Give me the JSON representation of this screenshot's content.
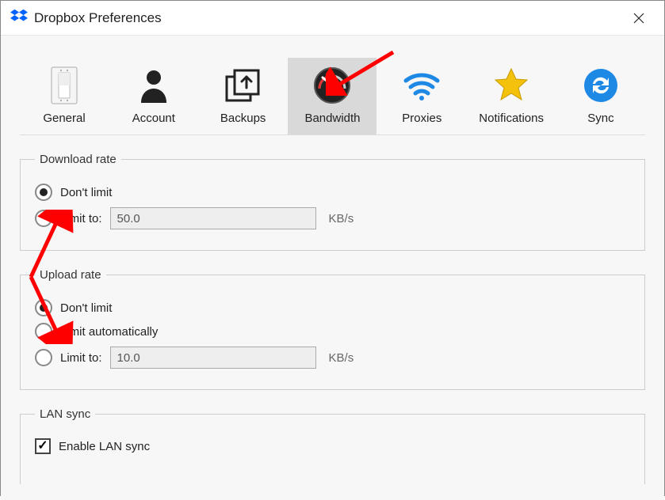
{
  "window": {
    "title": "Dropbox Preferences"
  },
  "tabs": {
    "general": "General",
    "account": "Account",
    "backups": "Backups",
    "bandwidth": "Bandwidth",
    "proxies": "Proxies",
    "notifications": "Notifications",
    "sync": "Sync"
  },
  "download": {
    "legend": "Download rate",
    "dont_limit": "Don't limit",
    "limit_to": "Limit to:",
    "value": "50.0",
    "unit": "KB/s"
  },
  "upload": {
    "legend": "Upload rate",
    "dont_limit": "Don't limit",
    "limit_auto": "Limit automatically",
    "limit_to": "Limit to:",
    "value": "10.0",
    "unit": "KB/s"
  },
  "lan": {
    "legend": "LAN sync",
    "enable": "Enable LAN sync"
  }
}
